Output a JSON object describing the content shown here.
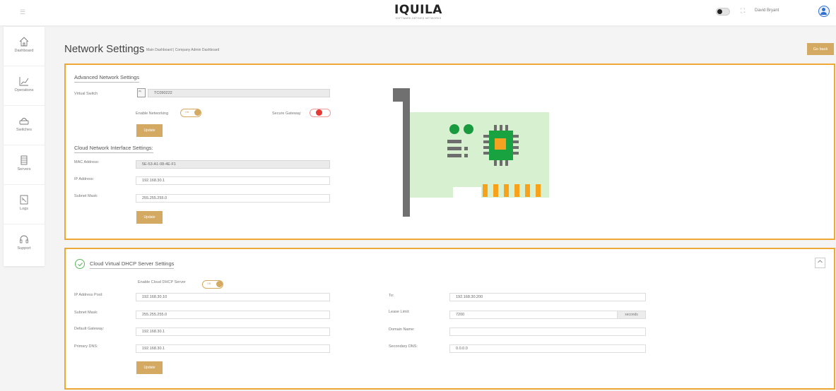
{
  "topbar": {
    "logo_text": "IQUILA",
    "logo_subtext": "SOFTWARE-DEFINED NETWORKS",
    "username": "David Bryant"
  },
  "sidebar": {
    "items": [
      {
        "label": "Dashboard",
        "icon": "home-icon"
      },
      {
        "label": "Operations",
        "icon": "chart-line-icon"
      },
      {
        "label": "Switches",
        "icon": "router-icon"
      },
      {
        "label": "Servers",
        "icon": "server-icon"
      },
      {
        "label": "Logs",
        "icon": "logs-icon"
      },
      {
        "label": "Support",
        "icon": "headset-icon"
      }
    ]
  },
  "header": {
    "title": "Network Settings",
    "breadcrumb": "Main Dashboard | Company Admin Dashboard",
    "go_back_label": "Go back"
  },
  "advanced": {
    "title": "Advanced Network Settings",
    "virtual_switch_label": "Virtual Switch",
    "virtual_switch_value": "TC090222",
    "virtual_switch_thumb": "[S]",
    "enable_networking_label": "Enable Networking",
    "enable_networking_state": "ON",
    "secure_gateway_label": "Secure Gateway",
    "update_label": "Update"
  },
  "cloud_interface": {
    "title": "Cloud Network Interface Settings:",
    "mac_label": "MAC Address:",
    "mac_value": "5E-53-A1-08-4E-F1",
    "ip_label": "IP Address:",
    "ip_value": "192.168.30.1",
    "subnet_label": "Subnet Mask:",
    "subnet_value": "255.255.255.0",
    "update_label": "Update"
  },
  "dhcp": {
    "title": "Cloud Virtual DHCP Server Settings",
    "enable_label": "Enable Cloud DHCP Server",
    "enable_state": "ON",
    "pool_label": "IP Address Pool:",
    "pool_value": "192.168.30.10",
    "to_label": "To:",
    "to_value": "192.168.30.200",
    "subnet_label": "Subnet Mask:",
    "subnet_value": "255.255.255.0",
    "lease_label": "Lease Limit:",
    "lease_value": "7200",
    "lease_unit": "seconds",
    "gateway_label": "Default Gateway:",
    "gateway_value": "192.168.30.1",
    "domain_label": "Domain Name:",
    "domain_value": "",
    "primary_dns_label": "Primary DNS:",
    "primary_dns_value": "192.168.30.1",
    "secondary_dns_label": "Secondary DNS:",
    "secondary_dns_value": "0.0.0.0",
    "update_label": "Update"
  },
  "colors": {
    "accent": "#d4a962",
    "panel_border": "#f0a835",
    "danger": "#e53935",
    "success": "#5cb85c"
  }
}
